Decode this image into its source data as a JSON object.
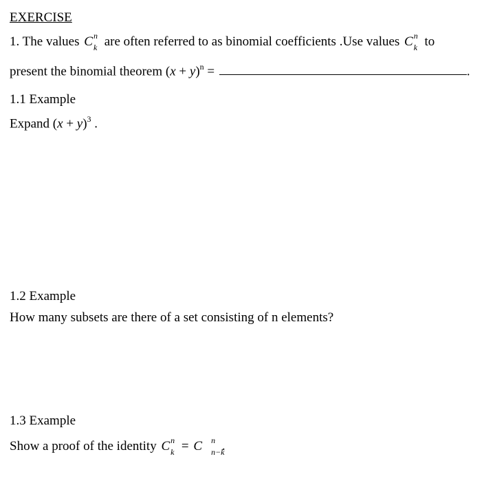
{
  "heading": "EXERCISE",
  "q1": {
    "prefix": "1.  The values  ",
    "mid": "   are often referred to as binomial coefficients .Use values  ",
    "suffix": "  to"
  },
  "q1_line2": {
    "prefix": "present the binomial theorem  ",
    "expr_open": "(",
    "expr_x": "x",
    "expr_plus": " + ",
    "expr_y": "y",
    "expr_close": ")",
    "exp": "n",
    "equals": " = ",
    "period": "."
  },
  "ex11": {
    "label": "1.1  Example",
    "line_prefix": "Expand  ",
    "expr_open": "(",
    "expr_x": "x",
    "expr_plus": " + ",
    "expr_y": "y",
    "expr_close": ")",
    "exp": "3",
    "period": " ."
  },
  "ex12": {
    "label": "1.2  Example",
    "text": "How many subsets are there of a set consisting of n elements?"
  },
  "ex13": {
    "label": "1.3  Example",
    "prefix": "Show a proof of the identity  ",
    "equals": " = ",
    "period": " ."
  },
  "cnk": {
    "C": "C",
    "n": "n",
    "k": "k",
    "nmk": "n−k"
  }
}
